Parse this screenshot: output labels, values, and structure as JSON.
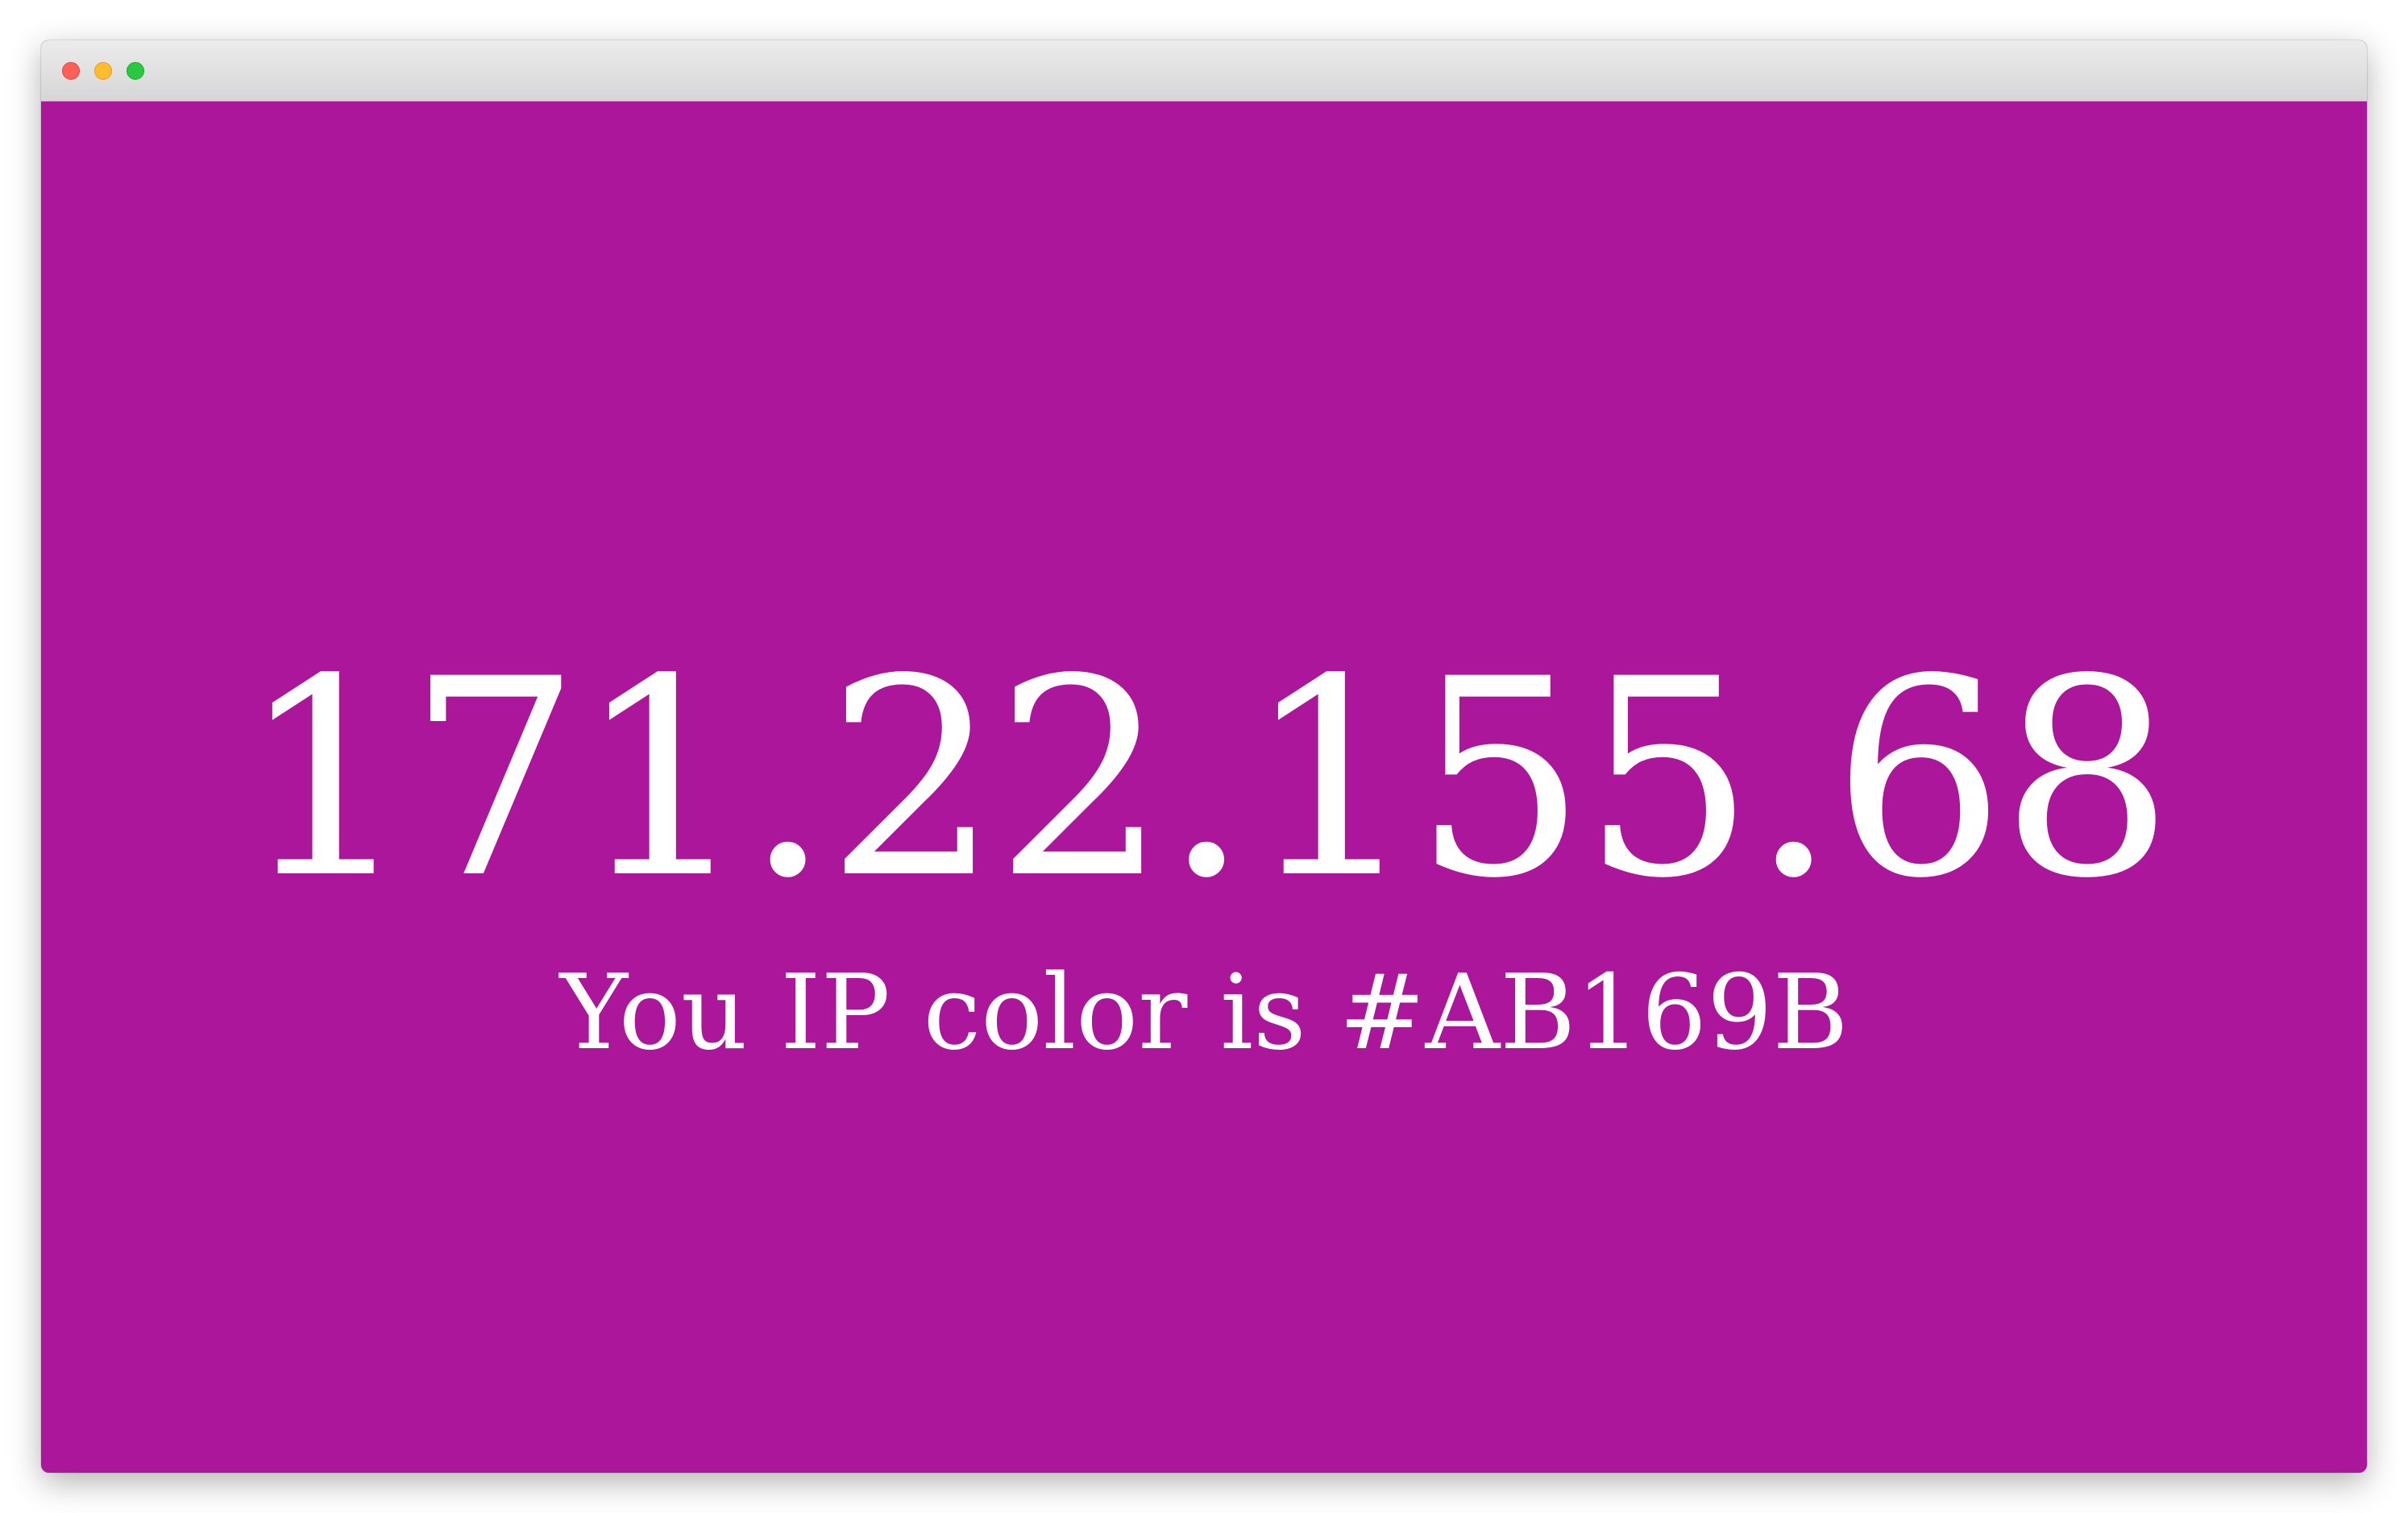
{
  "window": {
    "controls": [
      "close",
      "minimize",
      "zoom"
    ]
  },
  "page": {
    "ip_address": "171.22.155.68",
    "caption": "You IP color is #AB169B",
    "background_color": "#AB169B",
    "text_color": "#FFFFFF"
  }
}
